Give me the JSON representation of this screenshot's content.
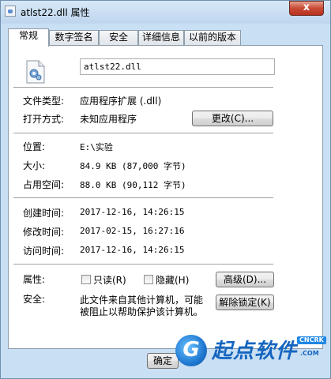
{
  "window": {
    "title": "atlst22.dll 属性",
    "close_glyph": "x"
  },
  "tabs": [
    {
      "label": "常规",
      "active": true
    },
    {
      "label": "数字签名"
    },
    {
      "label": "安全"
    },
    {
      "label": "详细信息"
    },
    {
      "label": "以前的版本"
    }
  ],
  "general": {
    "file_name": "atlst22.dll",
    "file_type_label": "文件类型:",
    "file_type_value": "应用程序扩展 (.dll)",
    "opens_with_label": "打开方式:",
    "opens_with_value": "未知应用程序",
    "change_button": "更改(C)...",
    "location_label": "位置:",
    "location_value": "E:\\实验",
    "size_label": "大小:",
    "size_value": "84.9 KB (87,000 字节)",
    "size_on_disk_label": "占用空间:",
    "size_on_disk_value": "88.0 KB (90,112 字节)",
    "created_label": "创建时间:",
    "created_value": "2017-12-16, 14:26:15",
    "modified_label": "修改时间:",
    "modified_value": "2017-02-15, 16:27:16",
    "accessed_label": "访问时间:",
    "accessed_value": "2017-12-16, 14:26:15",
    "attributes_label": "属性:",
    "readonly_label": "只读(R)",
    "readonly_checked": false,
    "hidden_label": "隐藏(H)",
    "hidden_checked": false,
    "advanced_button": "高级(D)...",
    "security_label": "安全:",
    "security_text_line1": "此文件来自其他计算机，可能",
    "security_text_line2": "被阻止以帮助保护该计算机。",
    "unblock_button": "解除锁定(K)"
  },
  "footer": {
    "ok_button": "确定"
  },
  "watermark": {
    "logo_glyph": "G",
    "text": "起点软件",
    "badge": "CNCRK",
    "domain": ".COM"
  },
  "colors": {
    "window_frame": "#c9dff3",
    "close_button": "#c74a35",
    "watermark_blue": "#1565c0"
  }
}
